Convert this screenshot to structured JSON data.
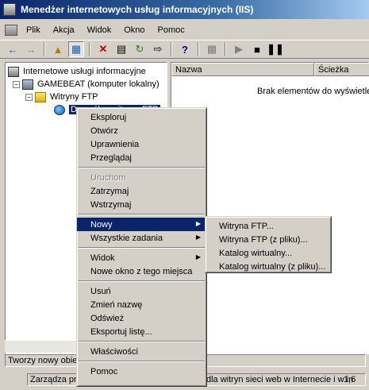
{
  "window": {
    "title": "Menedżer internetowych usług informacyjnych (IIS)"
  },
  "menubar": {
    "items": [
      "Plik",
      "Akcja",
      "Widok",
      "Okno",
      "Pomoc"
    ]
  },
  "tree": {
    "items": [
      {
        "label": "Internetowe usługi informacyjne"
      },
      {
        "label": "GAMEBEAT (komputer lokalny)"
      },
      {
        "label": "Witryny FTP"
      },
      {
        "label": "Domyślna witryna FTP"
      }
    ]
  },
  "list": {
    "columns": [
      "Nazwa",
      "Ścieżka"
    ],
    "empty_message": "Brak elementów do wyświetlenia"
  },
  "context_menu": {
    "items": [
      {
        "label": "Eksploruj",
        "disabled": false
      },
      {
        "label": "Otwórz",
        "disabled": false
      },
      {
        "label": "Uprawnienia",
        "disabled": false
      },
      {
        "label": "Przeglądaj",
        "disabled": false
      },
      {
        "sep": true
      },
      {
        "label": "Uruchom",
        "disabled": true
      },
      {
        "label": "Zatrzymaj",
        "disabled": false
      },
      {
        "label": "Wstrzymaj",
        "disabled": false
      },
      {
        "sep": true
      },
      {
        "label": "Nowy",
        "submenu": true,
        "hover": true
      },
      {
        "label": "Wszystkie zadania",
        "submenu": true
      },
      {
        "sep": true
      },
      {
        "label": "Widok",
        "submenu": true
      },
      {
        "label": "Nowe okno z tego miejsca"
      },
      {
        "sep": true
      },
      {
        "label": "Usuń"
      },
      {
        "label": "Zmień nazwę"
      },
      {
        "label": "Odśwież"
      },
      {
        "label": "Eksportuj listę..."
      },
      {
        "sep": true
      },
      {
        "label": "Właściwości"
      },
      {
        "sep": true
      },
      {
        "label": "Pomoc"
      }
    ]
  },
  "submenu": {
    "items": [
      "Witryna FTP...",
      "Witryna FTP (z pliku)...",
      "Katalog wirtualny...",
      "Katalog wirtualny (z pliku)..."
    ]
  },
  "status": {
    "line1": "Tworzy nowy obie",
    "line2_part1": "Zarządza pr",
    "line2_part2": "dla witryn sieci web w Internecie i w in",
    "line2_part3": "1,6"
  }
}
